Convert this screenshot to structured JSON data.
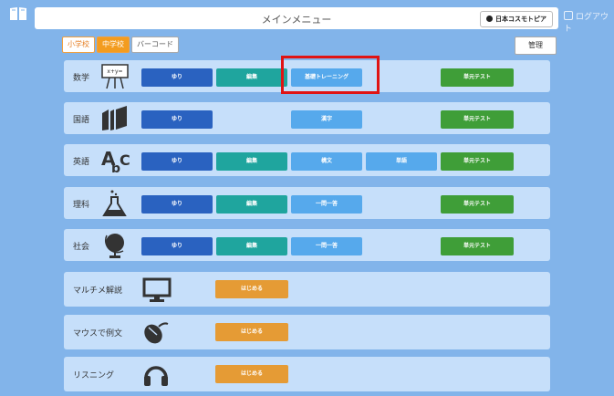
{
  "header": {
    "title": "メインメニュー",
    "org_button": "日本コスモトピア",
    "logout": "ログアウト",
    "book_icon": "book-icon"
  },
  "tabs": {
    "elementary": "小学校",
    "junior_high": "中学校",
    "barcode": "バーコード",
    "admin": "管理"
  },
  "subjects": {
    "math": {
      "label": "数学",
      "icon": "chalkboard-icon",
      "app": "ゆり",
      "edit": "編集",
      "basic_training": "基礎トレーニング",
      "unit_test": "単元テスト"
    },
    "japanese": {
      "label": "国語",
      "icon": "books-icon",
      "app": "ゆり",
      "kanji": "漢字",
      "unit_test": "単元テスト"
    },
    "english": {
      "label": "英語",
      "icon": "abc-icon",
      "app": "ゆり",
      "edit": "編集",
      "composition": "構文",
      "vocabulary": "単語",
      "unit_test": "単元テスト"
    },
    "science": {
      "label": "理科",
      "icon": "flask-icon",
      "app": "ゆり",
      "edit": "編集",
      "qa": "一問一答",
      "unit_test": "単元テスト"
    },
    "social": {
      "label": "社会",
      "icon": "globe-icon",
      "app": "ゆり",
      "edit": "編集",
      "qa": "一問一答",
      "unit_test": "単元テスト"
    }
  },
  "extras": {
    "multi": {
      "label": "マルチメ解説",
      "icon": "monitor-icon",
      "start": "はじめる"
    },
    "mouse": {
      "label": "マウスで例文",
      "icon": "mouse-icon",
      "start": "はじめる"
    },
    "listening": {
      "label": "リスニング",
      "icon": "headphones-icon",
      "start": "はじめる"
    }
  },
  "colors": {
    "background": "#82b4ea",
    "panel": "#c6dffa",
    "blue": "#2a62c0",
    "teal": "#1fa59e",
    "light_blue": "#56a9ec",
    "green": "#3f9e38",
    "orange": "#e59b35",
    "highlight": "#e01414"
  }
}
